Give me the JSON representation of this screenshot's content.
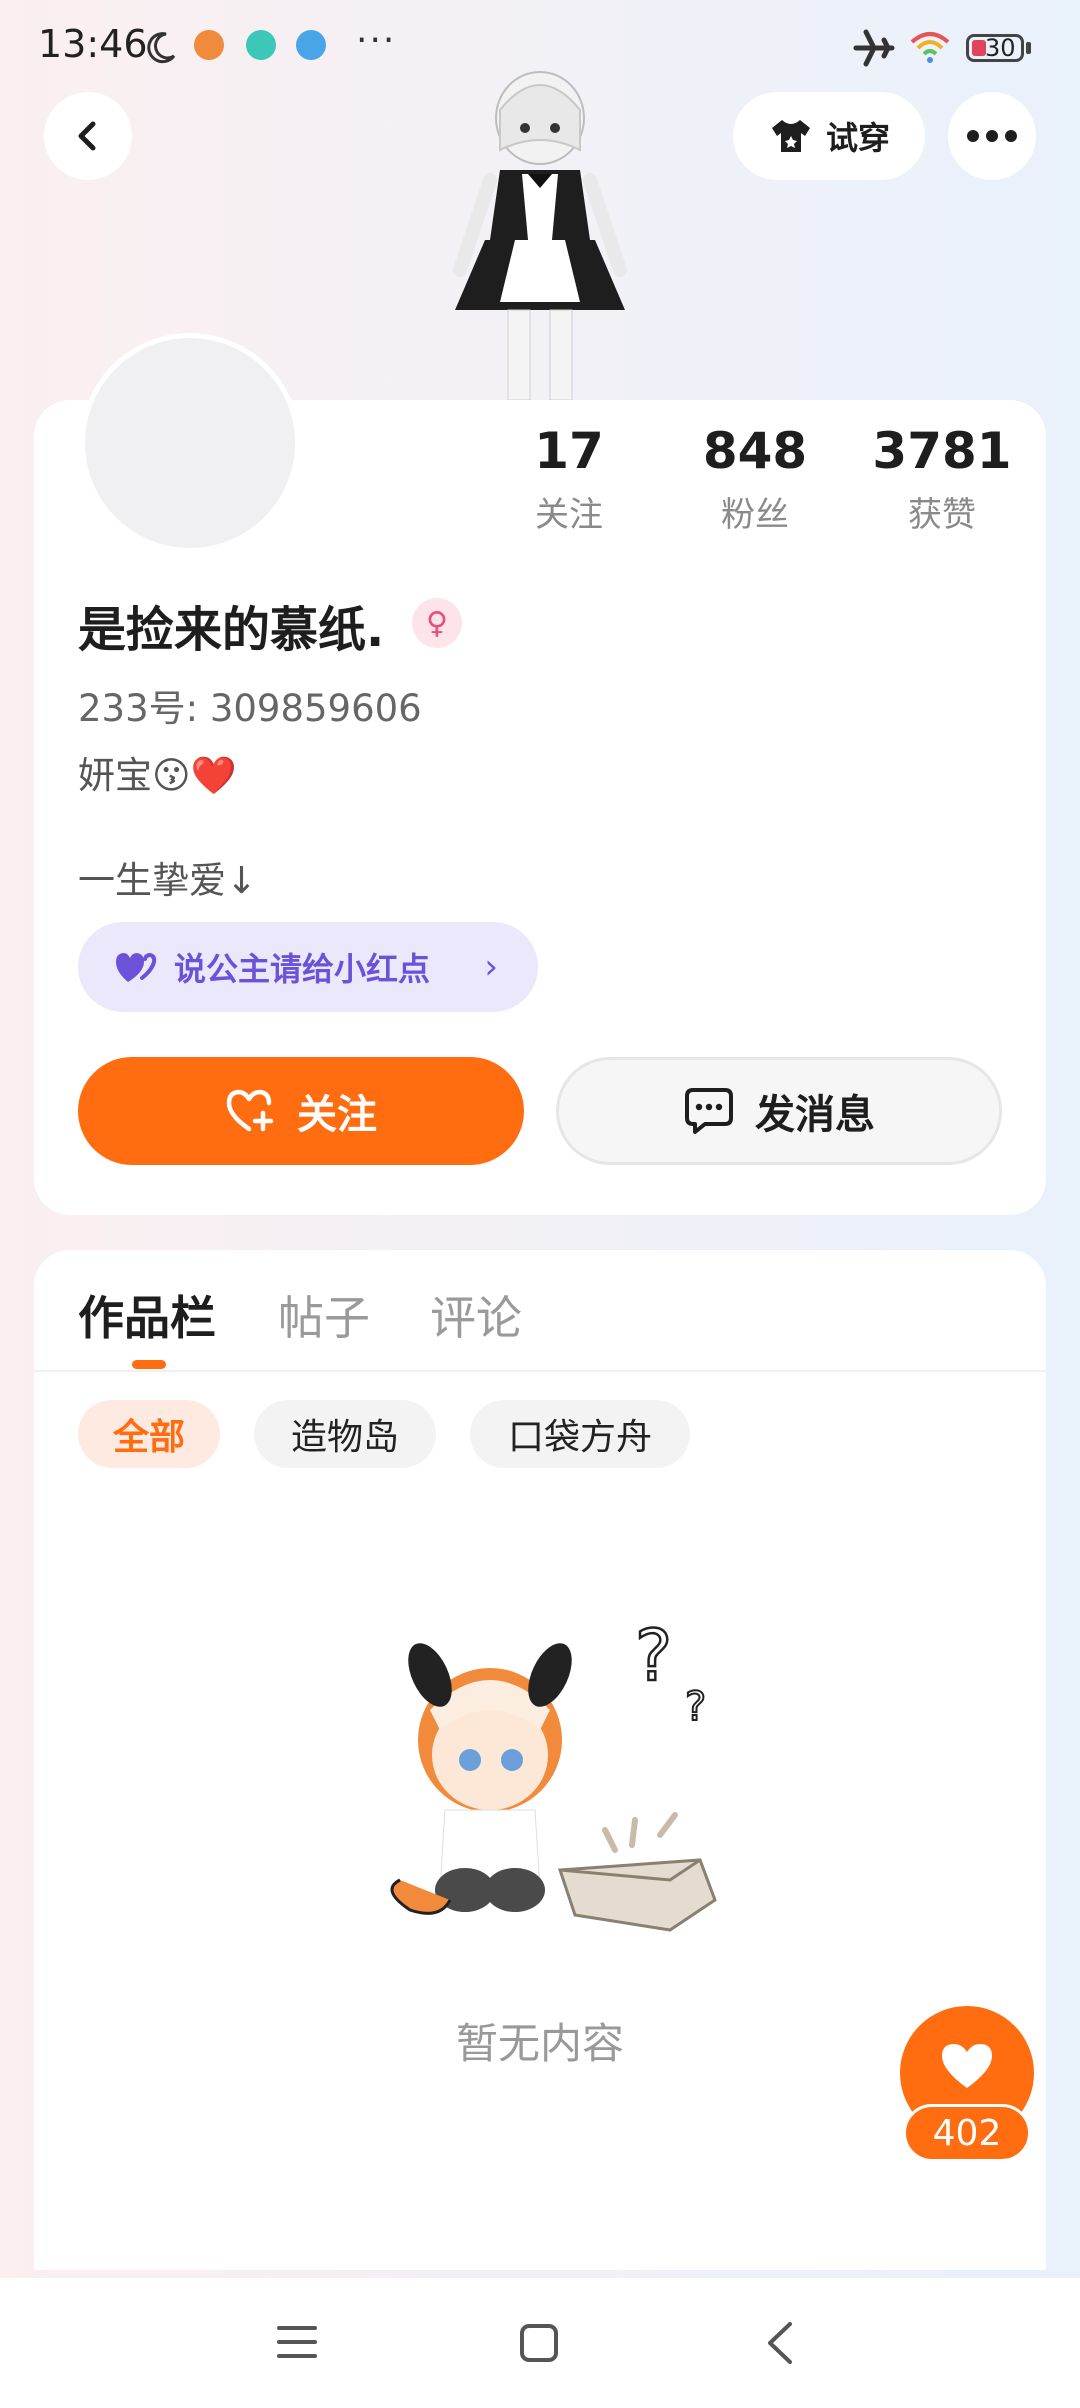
{
  "status_bar": {
    "time": "13:46",
    "icons": [
      "moon-icon",
      "shield-notification-icon",
      "chat-notification-icon",
      "app-notification-icon",
      "more-dots-icon",
      "airplane-icon",
      "wifi-icon"
    ],
    "battery": "30"
  },
  "header": {
    "back_icon": "chevron-left-icon",
    "tryon_label": "试穿",
    "more_icon": "more-icon"
  },
  "profile": {
    "stats": [
      {
        "value": "17",
        "label": "关注"
      },
      {
        "value": "848",
        "label": "粉丝"
      },
      {
        "value": "3781",
        "label": "获赞"
      }
    ],
    "username": "是捡来的慕纸.",
    "gender_icon": "female-icon",
    "uid": "233号: 309859606",
    "signature_line1": "妍宝😗❤️",
    "signature_line2": "一生挚爱↓",
    "pill_label": "说公主请给小红点",
    "follow_label": "关注",
    "message_label": "发消息"
  },
  "works": {
    "tabs": [
      "作品栏",
      "帖子",
      "评论"
    ],
    "chips": [
      "全部",
      "造物岛",
      "口袋方舟"
    ],
    "empty_text": "暂无内容"
  },
  "like": {
    "count": "402"
  },
  "colors": {
    "accent": "#ff6d10",
    "pill_bg": "#ebe8fb",
    "pill_text": "#6b52d8"
  }
}
